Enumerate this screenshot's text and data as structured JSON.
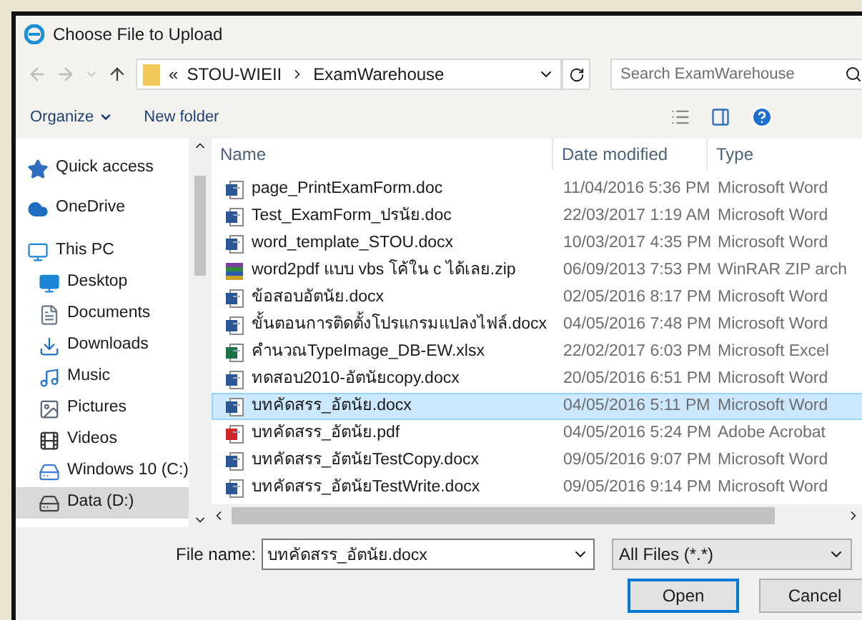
{
  "window": {
    "title": "Choose File to Upload"
  },
  "address": {
    "overflow": "«",
    "path": [
      "STOU-WIEII",
      "ExamWarehouse"
    ]
  },
  "search": {
    "placeholder": "Search ExamWarehouse"
  },
  "toolbar": {
    "organize": "Organize",
    "new_folder": "New folder"
  },
  "sidebar": {
    "items": [
      {
        "label": "Quick access",
        "kind": "star",
        "selected": false,
        "child": false
      },
      {
        "label": "OneDrive",
        "kind": "cloud",
        "selected": false,
        "child": false
      },
      {
        "label": "This PC",
        "kind": "pc",
        "selected": false,
        "child": false
      },
      {
        "label": "Desktop",
        "kind": "desktop",
        "selected": false,
        "child": true
      },
      {
        "label": "Documents",
        "kind": "documents",
        "selected": false,
        "child": true
      },
      {
        "label": "Downloads",
        "kind": "downloads",
        "selected": false,
        "child": true
      },
      {
        "label": "Music",
        "kind": "music",
        "selected": false,
        "child": true
      },
      {
        "label": "Pictures",
        "kind": "pictures",
        "selected": false,
        "child": true
      },
      {
        "label": "Videos",
        "kind": "videos",
        "selected": false,
        "child": true
      },
      {
        "label": "Windows 10 (C:)",
        "kind": "drive",
        "selected": false,
        "child": true
      },
      {
        "label": "Data (D:)",
        "kind": "drive2",
        "selected": true,
        "child": true
      }
    ]
  },
  "table": {
    "columns": [
      "Name",
      "Date modified",
      "Type"
    ],
    "rows": [
      {
        "kind": "doc",
        "name": "page_PrintExamForm.doc",
        "date": "11/04/2016 5:36 PM",
        "type": "Microsoft Word",
        "selected": false
      },
      {
        "kind": "doc",
        "name": "Test_ExamForm_ปรนัย.doc",
        "date": "22/03/2017 1:19 AM",
        "type": "Microsoft Word",
        "selected": false
      },
      {
        "kind": "docx",
        "name": "word_template_STOU.docx",
        "date": "10/03/2017 4:35 PM",
        "type": "Microsoft Word",
        "selected": false
      },
      {
        "kind": "zip",
        "name": "word2pdf แบบ vbs โค้ใน c ได้เลย.zip",
        "date": "06/09/2013 7:53 PM",
        "type": "WinRAR ZIP arch",
        "selected": false
      },
      {
        "kind": "docx",
        "name": "ข้อสอบอัตนัย.docx",
        "date": "02/05/2016 8:17 PM",
        "type": "Microsoft Word",
        "selected": false
      },
      {
        "kind": "docx",
        "name": "ขั้นตอนการติดตั้งโปรแกรมแปลงไฟล์.docx",
        "date": "04/05/2016 7:48 PM",
        "type": "Microsoft Word",
        "selected": false
      },
      {
        "kind": "xlsx",
        "name": "คำนวณTypeImage_DB-EW.xlsx",
        "date": "22/02/2017 6:03 PM",
        "type": "Microsoft Excel",
        "selected": false
      },
      {
        "kind": "docx",
        "name": "ทดสอบ2010-อัตนัยcopy.docx",
        "date": "20/05/2016 6:51 PM",
        "type": "Microsoft Word",
        "selected": false
      },
      {
        "kind": "docx",
        "name": "บทคัดสรร_อัตนัย.docx",
        "date": "04/05/2016 5:11 PM",
        "type": "Microsoft Word",
        "selected": true
      },
      {
        "kind": "pdf",
        "name": "บทคัดสรร_อัตนัย.pdf",
        "date": "04/05/2016 5:24 PM",
        "type": "Adobe Acrobat",
        "selected": false
      },
      {
        "kind": "docx",
        "name": "บทคัดสรร_อัตนัยTestCopy.docx",
        "date": "09/05/2016 9:07 PM",
        "type": "Microsoft Word",
        "selected": false
      },
      {
        "kind": "docx",
        "name": "บทคัดสรร_อัตนัยTestWrite.docx",
        "date": "09/05/2016 9:14 PM",
        "type": "Microsoft Word",
        "selected": false
      }
    ]
  },
  "file_name": {
    "label": "File name:",
    "value": "บทคัดสรร_อัตนัย.docx"
  },
  "file_type": {
    "value": "All Files (*.*)"
  },
  "buttons": [
    {
      "label": "Open",
      "kind": "default"
    },
    {
      "label": "Cancel",
      "kind": "normal"
    }
  ]
}
